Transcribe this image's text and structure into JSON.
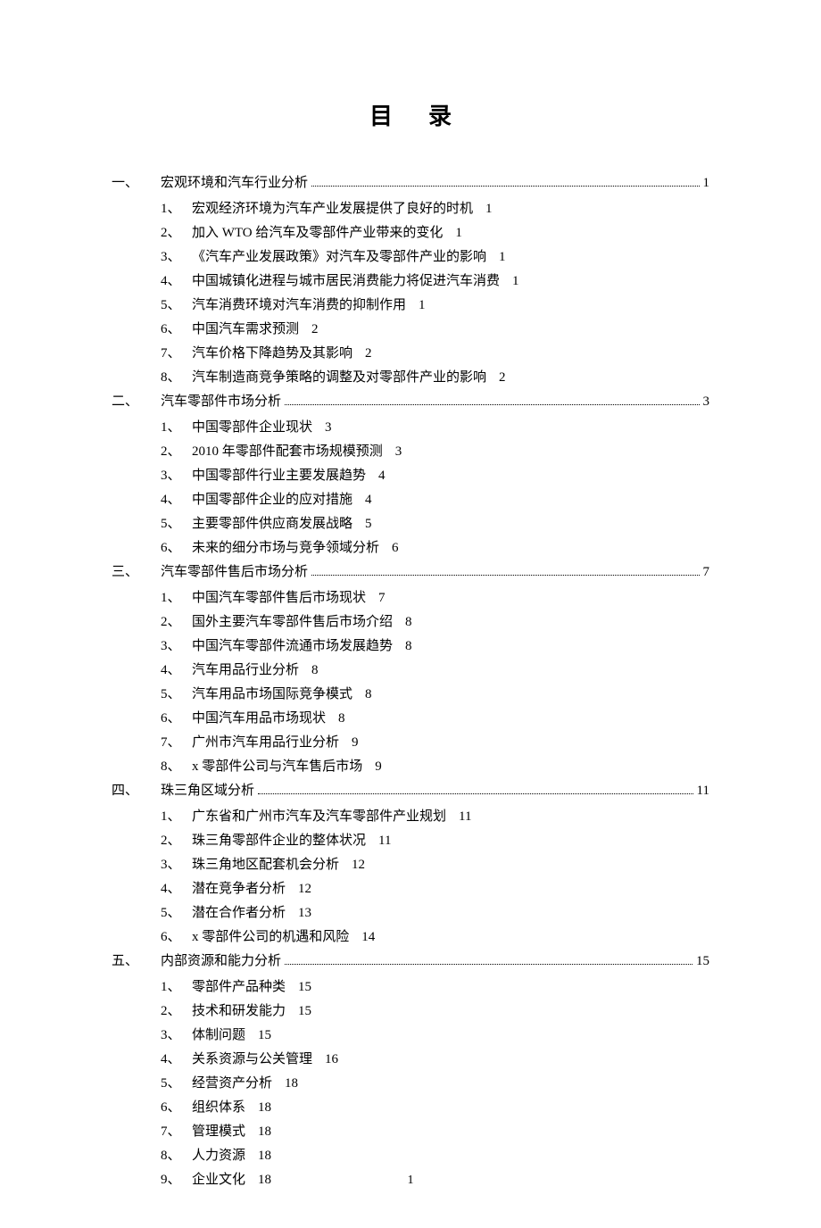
{
  "title": "目录",
  "page_number": "1",
  "sections": [
    {
      "num": "一、",
      "title": "宏观环境和汽车行业分析",
      "page": "1",
      "items": [
        {
          "n": "1、",
          "t": "宏观经济环境为汽车产业发展提供了良好的时机",
          "p": "1"
        },
        {
          "n": "2、",
          "t": "加入 WTO 给汽车及零部件产业带来的变化",
          "p": "1"
        },
        {
          "n": "3、",
          "t": "《汽车产业发展政策》对汽车及零部件产业的影响",
          "p": "1"
        },
        {
          "n": "4、",
          "t": "中国城镇化进程与城市居民消费能力将促进汽车消费",
          "p": "1"
        },
        {
          "n": "5、",
          "t": "汽车消费环境对汽车消费的抑制作用",
          "p": "1"
        },
        {
          "n": "6、",
          "t": "中国汽车需求预测",
          "p": "2"
        },
        {
          "n": "7、",
          "t": "汽车价格下降趋势及其影响",
          "p": "2"
        },
        {
          "n": "8、",
          "t": "汽车制造商竞争策略的调整及对零部件产业的影响",
          "p": "2"
        }
      ]
    },
    {
      "num": "二、",
      "title": "汽车零部件市场分析",
      "page": "3",
      "items": [
        {
          "n": "1、",
          "t": "中国零部件企业现状",
          "p": "3"
        },
        {
          "n": "2、",
          "t": "2010 年零部件配套市场规模预测",
          "p": "3"
        },
        {
          "n": "3、",
          "t": "中国零部件行业主要发展趋势",
          "p": "4"
        },
        {
          "n": "4、",
          "t": "中国零部件企业的应对措施",
          "p": "4"
        },
        {
          "n": "5、",
          "t": "主要零部件供应商发展战略",
          "p": "5"
        },
        {
          "n": "6、",
          "t": "未来的细分市场与竞争领域分析",
          "p": "6"
        }
      ]
    },
    {
      "num": "三、",
      "title": "汽车零部件售后市场分析",
      "page": "7",
      "items": [
        {
          "n": "1、",
          "t": "中国汽车零部件售后市场现状",
          "p": "7"
        },
        {
          "n": "2、",
          "t": "国外主要汽车零部件售后市场介绍",
          "p": "8"
        },
        {
          "n": "3、",
          "t": "中国汽车零部件流通市场发展趋势",
          "p": "8"
        },
        {
          "n": "4、",
          "t": "汽车用品行业分析",
          "p": "8"
        },
        {
          "n": "5、",
          "t": "汽车用品市场国际竞争模式",
          "p": "8"
        },
        {
          "n": "6、",
          "t": "中国汽车用品市场现状",
          "p": "8"
        },
        {
          "n": "7、",
          "t": "广州市汽车用品行业分析",
          "p": "9"
        },
        {
          "n": "8、",
          "t": "x 零部件公司与汽车售后市场",
          "p": "9"
        }
      ]
    },
    {
      "num": "四、",
      "title": "珠三角区域分析",
      "page": "11",
      "items": [
        {
          "n": "1、",
          "t": "广东省和广州市汽车及汽车零部件产业规划",
          "p": "11"
        },
        {
          "n": "2、",
          "t": "珠三角零部件企业的整体状况",
          "p": "11"
        },
        {
          "n": "3、",
          "t": "珠三角地区配套机会分析",
          "p": "12"
        },
        {
          "n": "4、",
          "t": "潜在竞争者分析",
          "p": "12"
        },
        {
          "n": "5、",
          "t": "潜在合作者分析",
          "p": "13"
        },
        {
          "n": "6、",
          "t": "x 零部件公司的机遇和风险",
          "p": "14"
        }
      ]
    },
    {
      "num": "五、",
      "title": "内部资源和能力分析",
      "page": "15",
      "items": [
        {
          "n": "1、",
          "t": "零部件产品种类",
          "p": "15"
        },
        {
          "n": "2、",
          "t": "技术和研发能力",
          "p": "15"
        },
        {
          "n": "3、",
          "t": "体制问题",
          "p": "15"
        },
        {
          "n": "4、",
          "t": "关系资源与公关管理",
          "p": "16"
        },
        {
          "n": "5、",
          "t": "经营资产分析",
          "p": "18"
        },
        {
          "n": "6、",
          "t": "组织体系",
          "p": "18"
        },
        {
          "n": "7、",
          "t": "管理模式",
          "p": "18"
        },
        {
          "n": "8、",
          "t": "人力资源",
          "p": "18"
        },
        {
          "n": "9、",
          "t": "企业文化",
          "p": "18"
        }
      ]
    }
  ]
}
